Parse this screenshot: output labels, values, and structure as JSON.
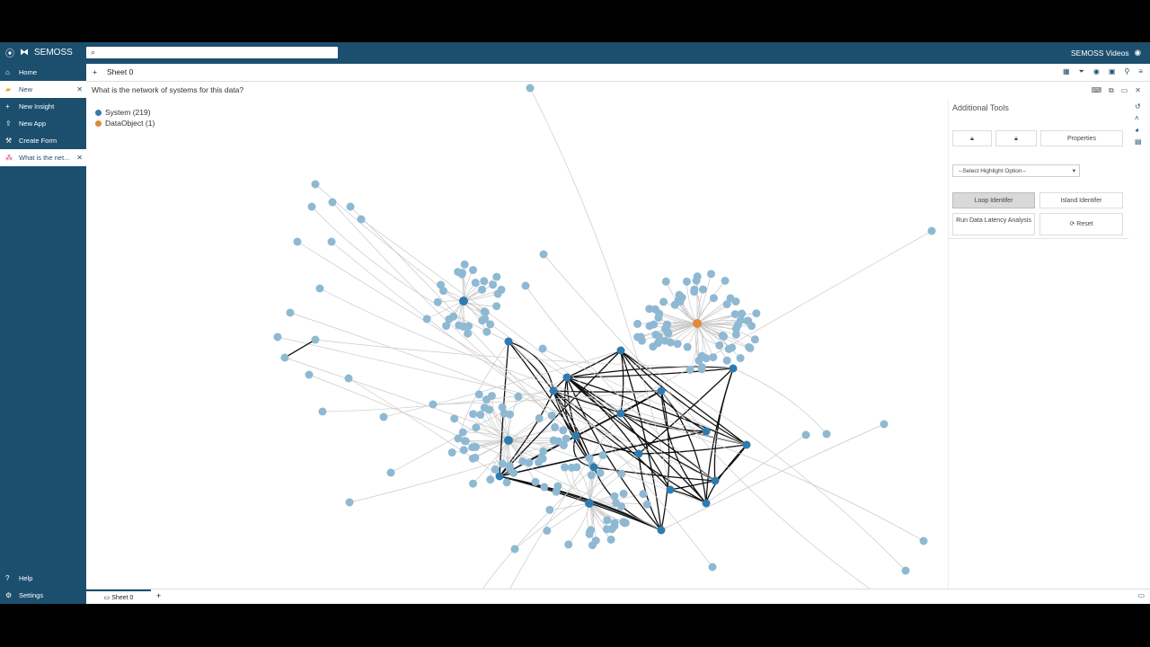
{
  "app": {
    "name": "SEMOSS",
    "user_link": "SEMOSS Videos"
  },
  "search": {
    "placeholder": ""
  },
  "sidebar": {
    "items": [
      {
        "label": "Home",
        "icon": "home-icon"
      },
      {
        "label": "New",
        "icon": "new-icon"
      },
      {
        "label": "New Insight",
        "icon": "plus-icon"
      },
      {
        "label": "New App",
        "icon": "upload-icon"
      },
      {
        "label": "Create Form",
        "icon": "wrench-icon"
      },
      {
        "label": "What is the net...",
        "icon": "network-icon"
      }
    ],
    "bottom": [
      {
        "label": "Help",
        "icon": "help-icon"
      },
      {
        "label": "Settings",
        "icon": "settings-icon"
      }
    ]
  },
  "sheet": {
    "name": "Sheet 0",
    "add_symbol": "+"
  },
  "insight": {
    "question": "What is the network of systems for this data?"
  },
  "legend": [
    {
      "label": "System (219)",
      "color": "#2f7bb0"
    },
    {
      "label": "DataObject (1)",
      "color": "#e08a3c"
    }
  ],
  "panel": {
    "title": "Additional Tools",
    "lock_icon_1": "lock-icon",
    "lock_icon_2": "lock-icon",
    "properties": "Properties",
    "select_placeholder": "--Select Highlight Option--",
    "loop_identifier": "Loop Identifer",
    "island_identifier": "Island Identifer",
    "run_latency": "Run Data Latency Analysis",
    "reset": "Reset"
  },
  "bottom": {
    "tab": "Sheet 0",
    "add": "+"
  },
  "colors": {
    "brand": "#1c4f6e",
    "node": "#8fb8d3",
    "node_dark": "#2f7bb0",
    "hub": "#e08a3c"
  }
}
